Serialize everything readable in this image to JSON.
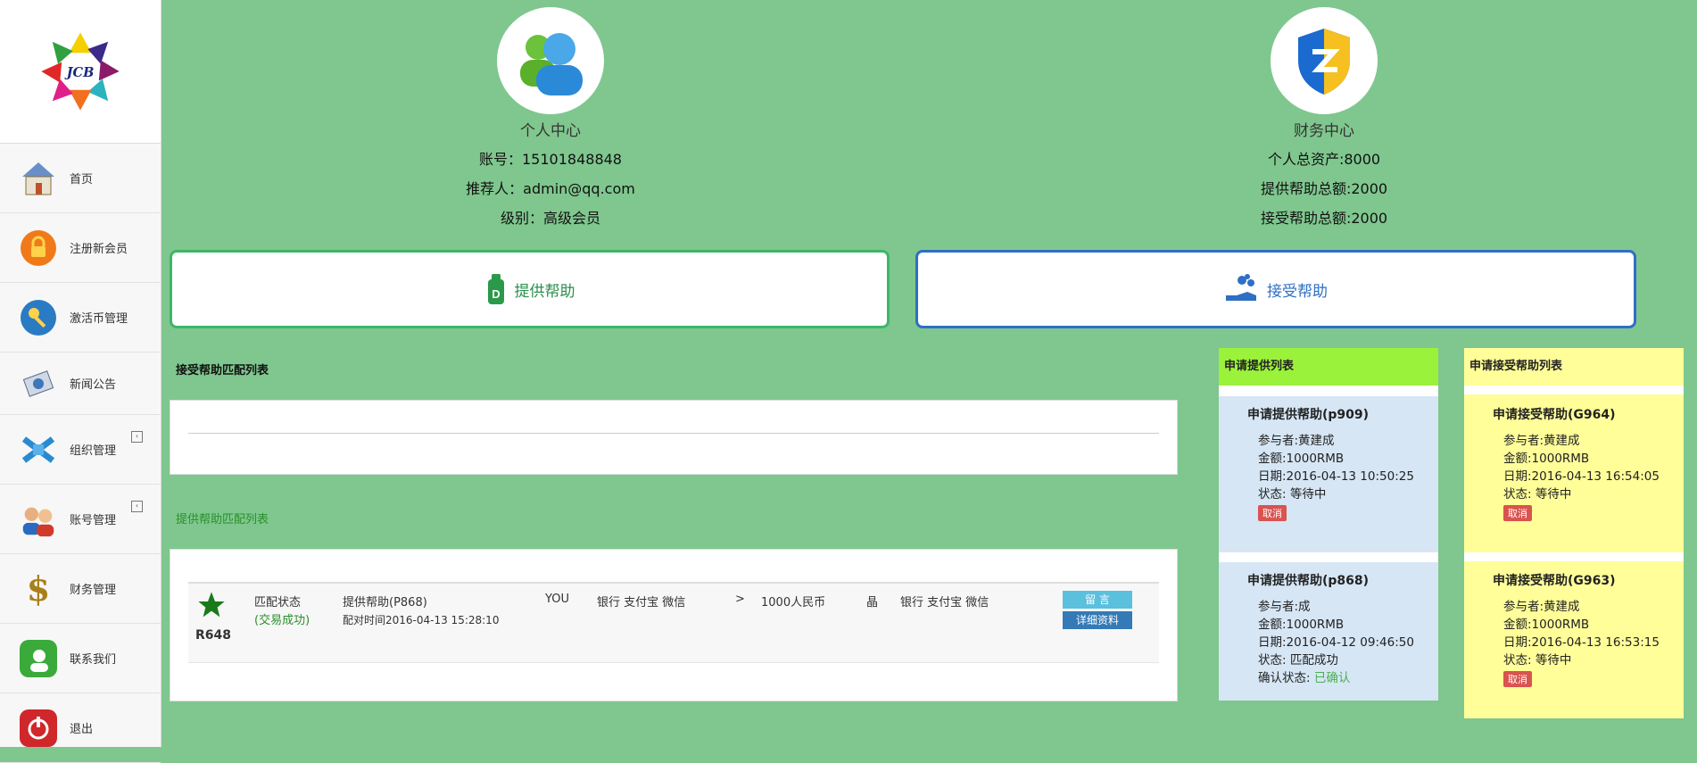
{
  "brand": {
    "logo_text": "JCB"
  },
  "sidebar": {
    "items": [
      {
        "label": "首页",
        "icon": "home-icon"
      },
      {
        "label": "注册新会员",
        "icon": "lock-icon"
      },
      {
        "label": "激活币管理",
        "icon": "key-icon"
      },
      {
        "label": "新闻公告",
        "icon": "news-icon"
      },
      {
        "label": "组织管理",
        "icon": "network-icon",
        "collapsible": true
      },
      {
        "label": "账号管理",
        "icon": "users-icon",
        "collapsible": true
      },
      {
        "label": "财务管理",
        "icon": "dollar-icon"
      },
      {
        "label": "联系我们",
        "icon": "contact-icon"
      },
      {
        "label": "退出",
        "icon": "power-icon"
      }
    ]
  },
  "personal": {
    "title": "个人中心",
    "account": "账号：15101848848",
    "referrer": "推荐人：admin@qq.com",
    "level": "级别：高级会员"
  },
  "finance": {
    "title": "财务中心",
    "total_assets": "个人总资产:8000",
    "provide_total": "提供帮助总额:2000",
    "receive_total": "接受帮助总额:2000"
  },
  "actions": {
    "provide_label": "提供帮助",
    "receive_label": "接受帮助"
  },
  "receive_match": {
    "title": "接受帮助匹配列表"
  },
  "provide_match": {
    "title": "提供帮助匹配列表",
    "row": {
      "code": "R648",
      "status_label": "匹配状态",
      "status_value": "(交易成功)",
      "name": "提供帮助(P868)",
      "time": "配对时间2016-04-13 15:28:10",
      "from": "YOU",
      "from_methods": "银行 支付宝 微信",
      "arrow": ">",
      "amount": "1000人民币",
      "to": "晶",
      "to_methods": "银行 支付宝 微信",
      "message_btn": "留  言",
      "detail_btn": "详细资料"
    }
  },
  "provide_list": {
    "title": "申请提供列表",
    "cards": [
      {
        "title": "申请提供帮助(p909)",
        "participant": "参与者:黄建成",
        "amount": "金额:1000RMB",
        "date": "日期:2016-04-13 10:50:25",
        "status": "状态: 等待中",
        "cancel": "取消"
      },
      {
        "title": "申请提供帮助(p868)",
        "participant": "参与者:成",
        "amount": "金额:1000RMB",
        "date": "日期:2016-04-12 09:46:50",
        "status": "状态: 匹配成功",
        "confirm_label": "确认状态:",
        "confirm_value": "已确认"
      }
    ]
  },
  "receive_list": {
    "title": "申请接受帮助列表",
    "cards": [
      {
        "title": "申请接受帮助(G964)",
        "participant": "参与者:黄建成",
        "amount": "金额:1000RMB",
        "date": "日期:2016-04-13 16:54:05",
        "status": "状态: 等待中",
        "cancel": "取消"
      },
      {
        "title": "申请接受帮助(G963)",
        "participant": "参与者:黄建成",
        "amount": "金额:1000RMB",
        "date": "日期:2016-04-13 16:53:15",
        "status": "状态: 等待中",
        "cancel": "取消"
      }
    ]
  },
  "colors": {
    "background": "#7fc78e",
    "provide_header": "#9bf23b",
    "provide_card": "#d6e6f5",
    "receive_bg": "#fffe99",
    "cancel": "#d9534f",
    "message_btn": "#5bc0de",
    "detail_btn": "#337ab7"
  }
}
